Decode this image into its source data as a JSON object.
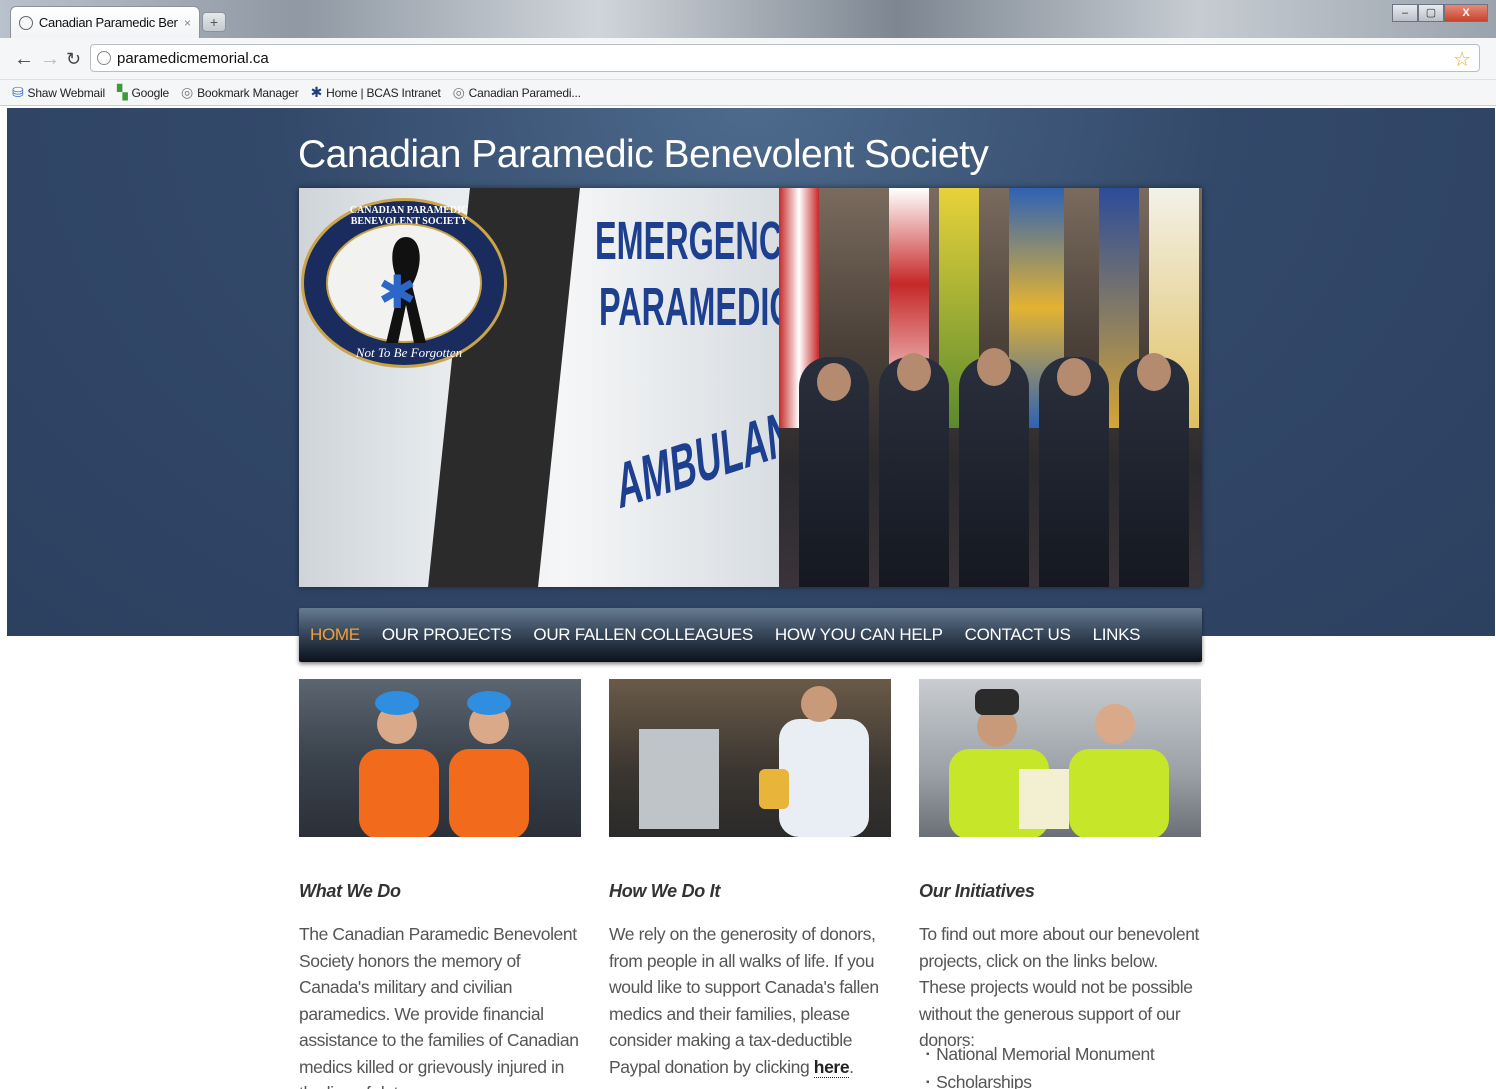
{
  "browser": {
    "tab_title": "Canadian Paramedic Benev",
    "tab_close": "×",
    "new_tab": "+",
    "url": "paramedicmemorial.ca",
    "bookmarks": [
      {
        "label": "Shaw Webmail",
        "icon": "shaw-icon"
      },
      {
        "label": "Google",
        "icon": "google-icon"
      },
      {
        "label": "Bookmark Manager",
        "icon": "globe-icon"
      },
      {
        "label": "Home | BCAS Intranet",
        "icon": "star-of-life-icon"
      },
      {
        "label": "Canadian Paramedi...",
        "icon": "globe-icon"
      }
    ],
    "window_buttons": {
      "minimize": "–",
      "maximize": "▢",
      "close": "X"
    }
  },
  "site": {
    "title": "Canadian Paramedic Benevolent Society",
    "emblem_top": "CANADIAN PARAMEDIC BENEVOLENT SOCIETY",
    "emblem_bottom": "Not To Be Forgotten",
    "banner_text": [
      "EMERGENCY",
      "PARAMEDIC",
      "AMBULANCE"
    ],
    "nav": [
      {
        "label": "HOME",
        "active": true
      },
      {
        "label": "OUR PROJECTS",
        "active": false
      },
      {
        "label": "OUR FALLEN COLLEAGUES",
        "active": false
      },
      {
        "label": "HOW YOU CAN HELP",
        "active": false
      },
      {
        "label": "CONTACT US",
        "active": false
      },
      {
        "label": "LINKS",
        "active": false
      }
    ],
    "columns": [
      {
        "title": "What We Do",
        "text": "The Canadian Paramedic Benevolent Society honors the memory of Canada's military and civilian paramedics. We provide financial assistance to the families of Canadian medics killed or grievously injured in the line of duty."
      },
      {
        "title": "How We Do It",
        "text": "We rely on the generosity of donors, from people in all walks of life. If you would like to support Canada's fallen medics and their families, please consider making a tax-deductible Paypal donation by clicking",
        "link": "here",
        "after_link": "."
      },
      {
        "title": "Our Initiatives",
        "text": "To find out more about our benevolent projects, click on the links below. These projects would not be possible without the generous support of our donors:",
        "list": [
          "National Memorial Monument",
          "Scholarships"
        ]
      }
    ]
  },
  "colors": {
    "header_bg": "#33496a",
    "nav_active": "#f0a23a",
    "text": "#555555"
  }
}
